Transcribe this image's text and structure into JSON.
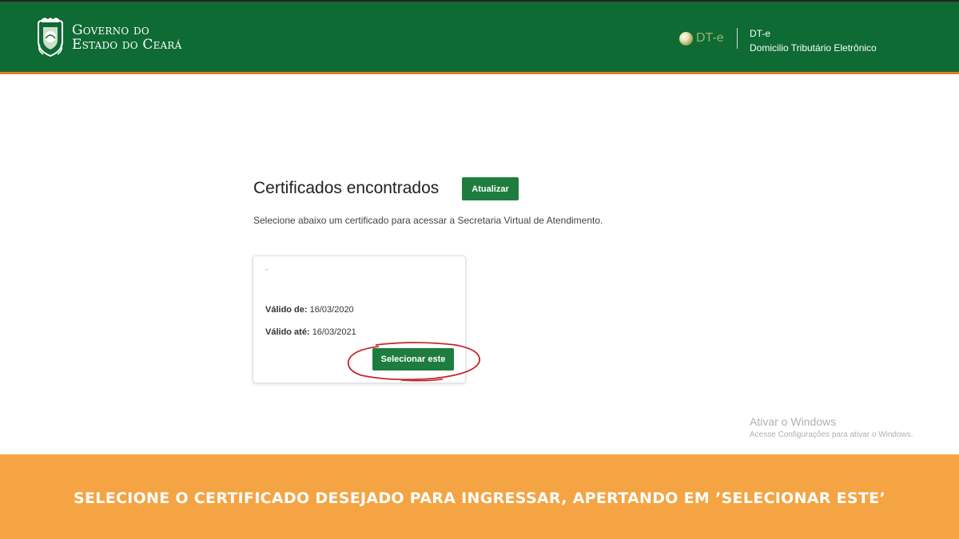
{
  "header": {
    "gov_line1": "Governo do",
    "gov_line2": "Estado do Ceará",
    "dte_logo_text": "DT-e",
    "dte_title": "DT-e",
    "dte_subtitle": "Domicilio Tributário Eletrônico"
  },
  "main": {
    "title": "Certificados encontrados",
    "refresh_label": "Atualizar",
    "subtitle": "Selecione abaixo um certificado para acessar a Secretaria Virtual de Atendimento."
  },
  "certificate": {
    "name": "-",
    "valid_from_label": "Válido de:",
    "valid_from": "16/03/2020",
    "valid_to_label": "Válido até:",
    "valid_to": "16/03/2021",
    "select_label": "Selecionar este"
  },
  "windows_watermark": {
    "title": "Ativar o Windows",
    "subtitle": "Acesse Configurações para ativar o Windows."
  },
  "footer": {
    "caption": "SELECIONE O CERTIFICADO DESEJADO PARA INGRESSAR, APERTANDO EM ’SELECIONAR ESTE’"
  },
  "colors": {
    "header_green": "#0e6b34",
    "button_green": "#1e7d3e",
    "footer_orange": "#f4a443",
    "highlight_red": "#c0282d"
  }
}
